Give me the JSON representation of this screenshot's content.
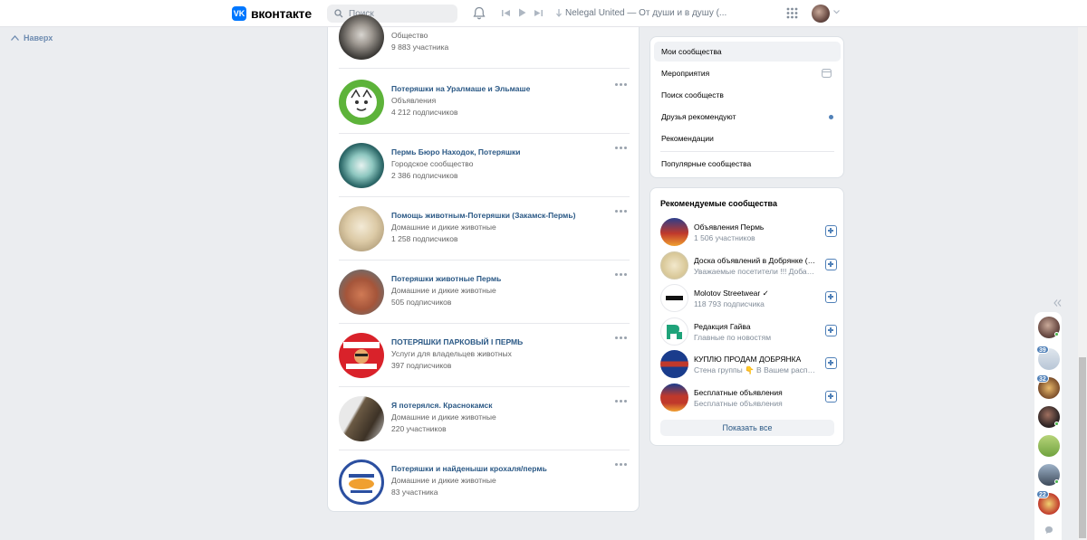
{
  "header": {
    "logo_mark": "VK",
    "logo_text": "вконтакте",
    "search_placeholder": "Поиск",
    "track_title": "Nelegal United — От души и в душу (..."
  },
  "nav": {
    "to_top": "Наверх"
  },
  "groups": [
    {
      "name": "",
      "category": "Общество",
      "count": "9 883 участника",
      "avatar_color": "#6f6a65"
    },
    {
      "name": "Потеряшки на Уралмаше и Эльмаше",
      "category": "Объявления",
      "count": "4 212 подписчиков",
      "avatar_color": "#5db33a"
    },
    {
      "name": "Пермь Бюро Находок, Потеряшки",
      "category": "Городское сообщество",
      "count": "2 386 подписчиков",
      "avatar_color": "#2f8c8c"
    },
    {
      "name": "Помощь животным-Потеряшки (Закамск-Пермь)",
      "category": "Домашние и дикие животные",
      "count": "1 258 подписчиков",
      "avatar_color": "#d9c8a8"
    },
    {
      "name": "Потеряшки животные Пермь",
      "category": "Домашние и дикие животные",
      "count": "505 подписчиков",
      "avatar_color": "#b5654a"
    },
    {
      "name": "ПОТЕРЯШКИ ПАРКОВЫЙ I ПЕРМЬ",
      "category": "Услуги для владельцев животных",
      "count": "397 подписчиков",
      "avatar_color": "#d9222a"
    },
    {
      "name": "Я потерялся. Краснокамск",
      "category": "Домашние и дикие животные",
      "count": "220 участников",
      "avatar_color": "#6b5a44"
    },
    {
      "name": "Потеряшки и найденыши крохаля/пермь",
      "category": "Домашние и дикие животные",
      "count": "83 участника",
      "avatar_color": "#2b4fa0"
    }
  ],
  "menu": {
    "items": [
      "Мои сообщества",
      "Мероприятия",
      "Поиск сообществ",
      "Друзья рекомендуют",
      "Рекомендации"
    ],
    "popular": "Популярные сообщества"
  },
  "recommended": {
    "title": "Рекомендуемые сообщества",
    "items": [
      {
        "name": "Объявления Пермь",
        "sub": "1 506 участников",
        "avatar_color": "#c0392b"
      },
      {
        "name": "Доска объявлений в Добрянке ( к...",
        "sub": "Уважаемые посетители !!! Добавл...",
        "avatar_color": "#e8d9b0"
      },
      {
        "name": "Molotov Streetwear ✓",
        "sub": "118 793 подписчика",
        "avatar_color": "#ffffff"
      },
      {
        "name": "Редакция Гайва",
        "sub": "Главные по новостям",
        "avatar_color": "#ffffff"
      },
      {
        "name": "КУПЛЮ ПРОДАМ ДОБРЯНКА",
        "sub": "Стена группы 👇 В Вашем распор...",
        "avatar_color": "#1a3c8c"
      },
      {
        "name": "Бесплатные объявления",
        "sub": "Бесплатные объявления",
        "avatar_color": "#c0392b"
      }
    ],
    "show_all": "Показать все"
  },
  "chats": {
    "badges": [
      "39",
      "32",
      "22"
    ]
  },
  "colors": {
    "accent": "#0077ff",
    "link": "#2a5885",
    "bg": "#ebedf0"
  }
}
